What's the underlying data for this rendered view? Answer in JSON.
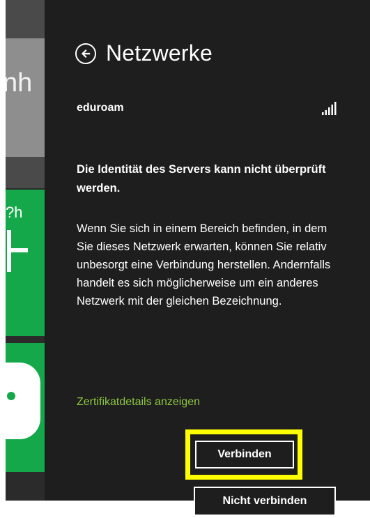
{
  "background": {
    "partial_text": "nh",
    "tile_label": "?h"
  },
  "panel": {
    "title": "Netzwerke",
    "network": {
      "name": "eduroam",
      "signal": "full"
    },
    "warning": "Die Identität des Servers kann nicht überprüft werden.",
    "body": "Wenn Sie sich in einem Bereich befinden, in dem Sie dieses Netzwerk erwarten, können Sie relativ unbesorgt eine Verbindung herstellen. Andernfalls handelt es sich möglicherweise um ein anderes Netzwerk mit der gleichen Bezeichnung.",
    "cert_link": "Zertifikatdetails anzeigen",
    "connect_label": "Verbinden",
    "no_connect_label": "Nicht verbinden"
  },
  "colors": {
    "panel_bg": "#1e1e1e",
    "accent_link": "#8dc63f",
    "highlight": "#ffff00",
    "tile_green": "#14a84b"
  }
}
